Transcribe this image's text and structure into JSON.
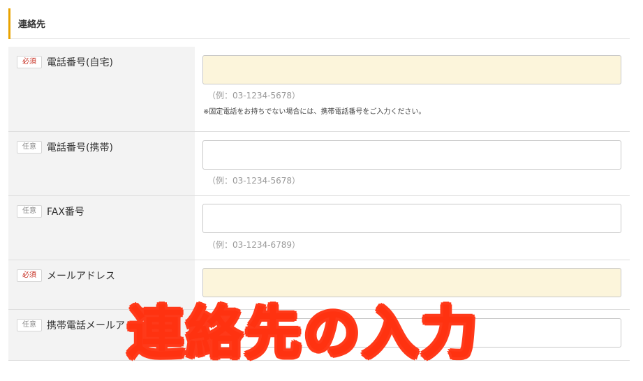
{
  "section": {
    "title": "連絡先"
  },
  "rows": [
    {
      "badge": "必須",
      "label": "電話番号(自宅)",
      "value": "",
      "hint": "（例：03-1234-5678）",
      "note": "※固定電話をお持ちでない場合には、携帯電話番号をご入力ください。"
    },
    {
      "badge": "任意",
      "label": "電話番号(携帯)",
      "value": "",
      "hint": "（例：03-1234-5678）"
    },
    {
      "badge": "任意",
      "label": "FAX番号",
      "value": "",
      "hint": "（例：03-1234-6789）"
    },
    {
      "badge": "必須",
      "label": "メールアドレス",
      "value": ""
    },
    {
      "badge": "任意",
      "label": "携帯電話メールアド",
      "value": ""
    }
  ],
  "overlay": {
    "caption": "連絡先の入力"
  },
  "colors": {
    "accent": "#e9a300",
    "required_badge": "#c62b1e",
    "required_field_bg": "#fcf5db",
    "caption": "#ff3210"
  }
}
